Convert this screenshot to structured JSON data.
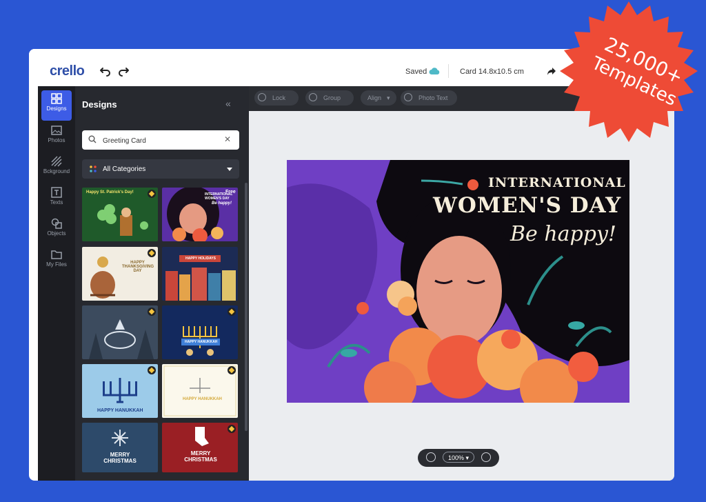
{
  "app": {
    "logo": "crello"
  },
  "topbar": {
    "saved": "Saved",
    "card_size": "Card 14.8x10.5 cm"
  },
  "rail": {
    "items": [
      {
        "label": "Designs",
        "icon": "designs-icon",
        "active": true
      },
      {
        "label": "Photos",
        "icon": "photos-icon"
      },
      {
        "label": "Bckground",
        "icon": "background-icon"
      },
      {
        "label": "Texts",
        "icon": "texts-icon"
      },
      {
        "label": "Objects",
        "icon": "objects-icon"
      },
      {
        "label": "My Files",
        "icon": "folder-icon"
      }
    ]
  },
  "panel": {
    "title": "Designs",
    "search": {
      "value": "Greeting Card",
      "placeholder": ""
    },
    "category": "All Categories"
  },
  "templates": [
    {
      "text": "Happy St. Patrick's Day!"
    },
    {
      "text": "INTERNATIONAL WOMEN'S DAY",
      "text2": "Be happy!",
      "badge": "Free"
    },
    {
      "text": "HAPPY THANKSGIVING DAY"
    },
    {
      "text": "HAPPY HOLIDAYS"
    },
    {
      "text": ""
    },
    {
      "text": "HAPPY HANUKKAH"
    },
    {
      "text": "HAPPY HANUKKAH"
    },
    {
      "text": "HAPPY HANUKKAH"
    },
    {
      "text": "MERRY CHRISTMAS"
    },
    {
      "text": "MERRY CHRISTMAS"
    }
  ],
  "toolbar": {
    "lock": "Lock",
    "group": "Group",
    "align": "Align",
    "photo_text": "Photo Text"
  },
  "card": {
    "line1": "INTERNATIONAL",
    "line2": "WOMEN'S DAY",
    "line3": "Be happy!"
  },
  "zoom": {
    "level": "100% ▾"
  },
  "promo": {
    "line1": "25,000+",
    "line2": "Templates"
  },
  "colors": {
    "background": "#2a56d3",
    "accent": "#3d5ce6",
    "badge": "#ee4b36"
  }
}
